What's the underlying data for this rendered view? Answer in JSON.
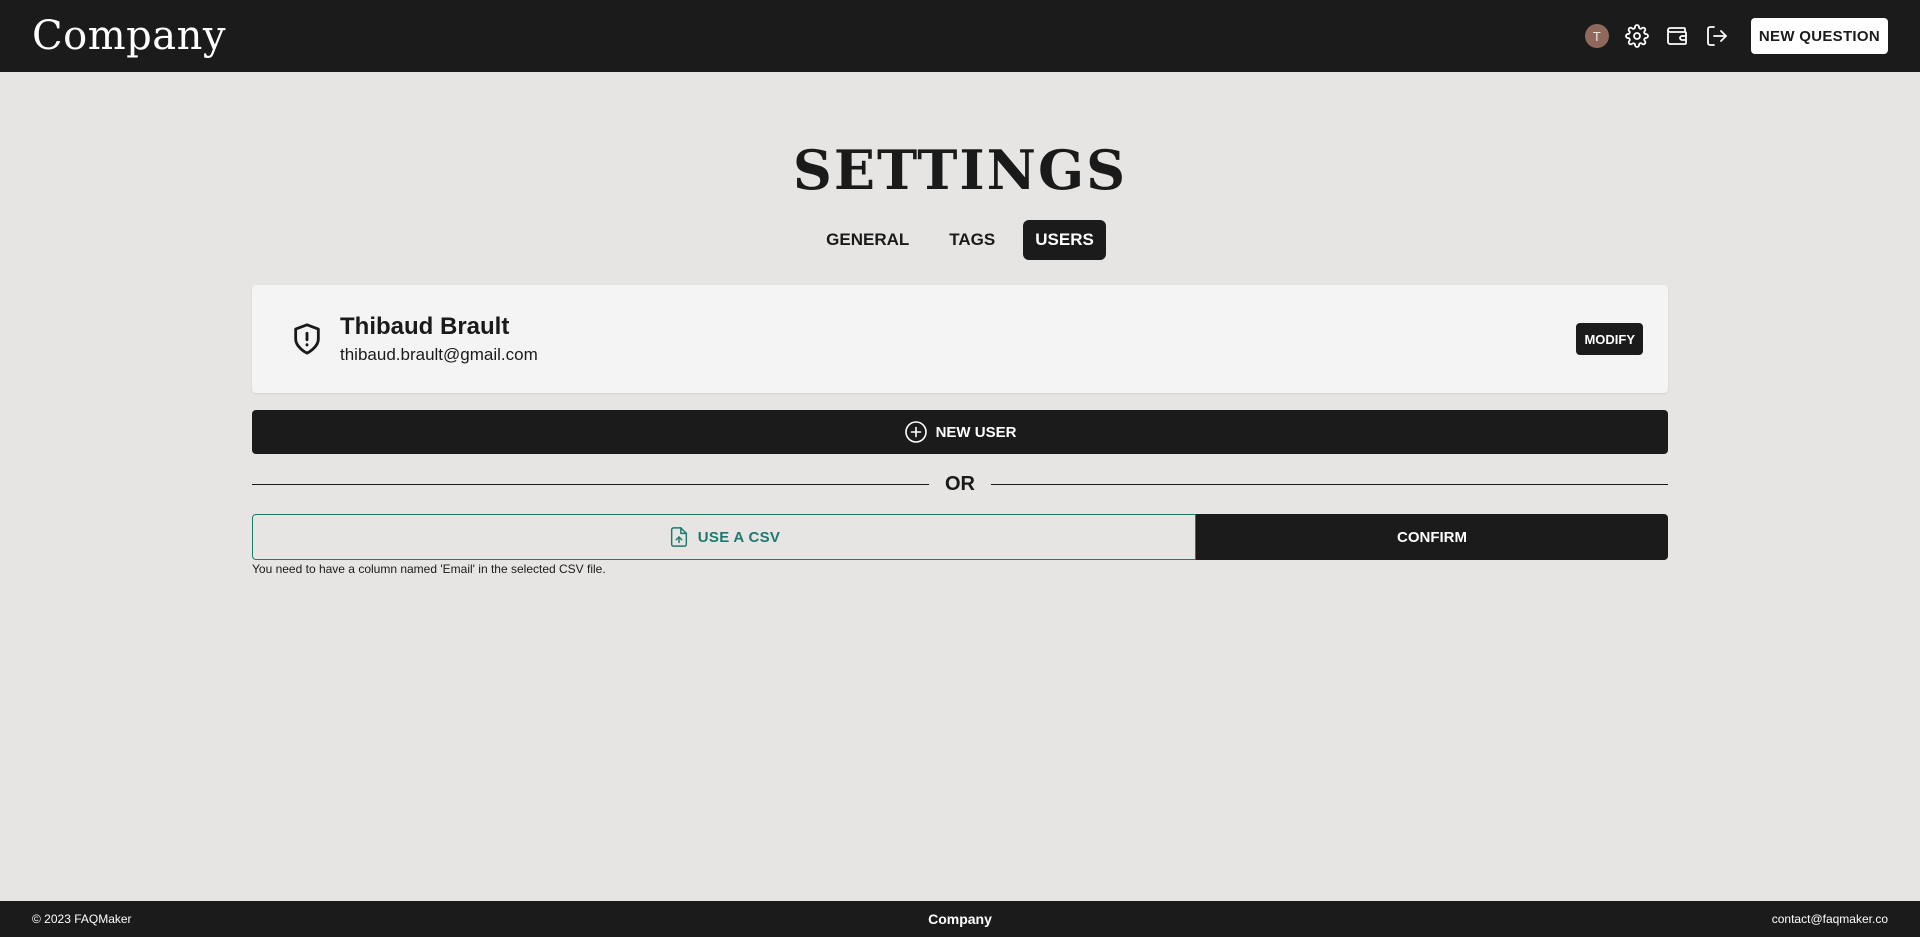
{
  "header": {
    "brand": "Company",
    "avatar_initial": "T",
    "icons": [
      "settings-icon",
      "wallet-icon",
      "logout-icon"
    ],
    "new_question_label": "NEW QUESTION"
  },
  "page": {
    "title": "SETTINGS",
    "tabs": [
      {
        "label": "GENERAL",
        "active": false
      },
      {
        "label": "TAGS",
        "active": false
      },
      {
        "label": "USERS",
        "active": true
      }
    ]
  },
  "users": [
    {
      "name": "Thibaud Brault",
      "email": "thibaud.brault@gmail.com",
      "role_icon": "shield-alert-icon",
      "modify_label": "MODIFY"
    }
  ],
  "actions": {
    "new_user_label": "NEW USER",
    "or_label": "OR",
    "use_csv_label": "USE A CSV",
    "confirm_label": "CONFIRM",
    "csv_hint": "You need to have a column named 'Email' in the selected CSV file."
  },
  "footer": {
    "copyright": "© 2023 FAQMaker",
    "center": "Company",
    "contact": "contact@faqmaker.co"
  },
  "colors": {
    "header_bg": "#1b1b1b",
    "page_bg": "#e6e5e3",
    "accent_teal": "#1d7a6e",
    "avatar_bg": "#8f6a5c"
  }
}
